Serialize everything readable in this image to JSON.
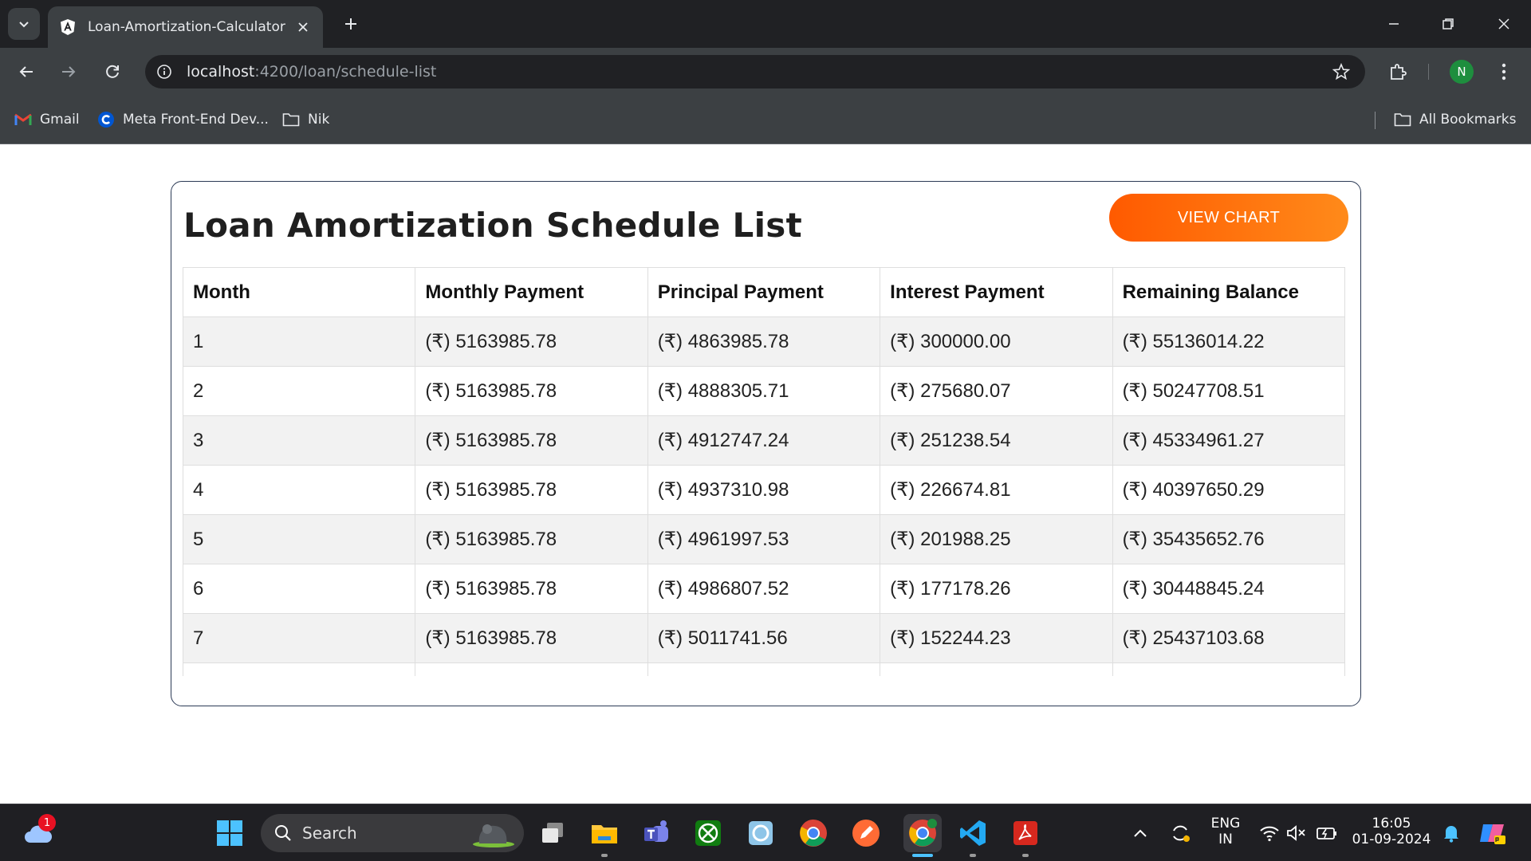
{
  "browser": {
    "tab_title": "Loan-Amortization-Calculator",
    "url_host": "localhost",
    "url_rest": ":4200/loan/schedule-list",
    "profile_initial": "N",
    "bookmarks": [
      {
        "label": "Gmail",
        "icon": "gmail-icon"
      },
      {
        "label": "Meta Front-End Dev...",
        "icon": "coursera-icon"
      },
      {
        "label": "Nik",
        "icon": "folder-icon"
      }
    ],
    "all_bookmarks_label": "All Bookmarks"
  },
  "page": {
    "title": "Loan Amortization Schedule List",
    "view_chart_label": "VIEW CHART",
    "accent_color": "#ff6a0d"
  },
  "table": {
    "headers": [
      "Month",
      "Monthly Payment",
      "Principal Payment",
      "Interest Payment",
      "Remaining Balance"
    ],
    "rows": [
      [
        "1",
        "(₹) 5163985.78",
        "(₹) 4863985.78",
        "(₹) 300000.00",
        "(₹) 55136014.22"
      ],
      [
        "2",
        "(₹) 5163985.78",
        "(₹) 4888305.71",
        "(₹) 275680.07",
        "(₹) 50247708.51"
      ],
      [
        "3",
        "(₹) 5163985.78",
        "(₹) 4912747.24",
        "(₹) 251238.54",
        "(₹) 45334961.27"
      ],
      [
        "4",
        "(₹) 5163985.78",
        "(₹) 4937310.98",
        "(₹) 226674.81",
        "(₹) 40397650.29"
      ],
      [
        "5",
        "(₹) 5163985.78",
        "(₹) 4961997.53",
        "(₹) 201988.25",
        "(₹) 35435652.76"
      ],
      [
        "6",
        "(₹) 5163985.78",
        "(₹) 4986807.52",
        "(₹) 177178.26",
        "(₹) 30448845.24"
      ],
      [
        "7",
        "(₹) 5163985.78",
        "(₹) 5011741.56",
        "(₹) 152244.23",
        "(₹) 25437103.68"
      ],
      [
        "",
        "",
        "",
        "",
        ""
      ]
    ]
  },
  "taskbar": {
    "search_label": "Search",
    "weather_badge": "1",
    "lang_line1": "ENG",
    "lang_line2": "IN",
    "time": "16:05",
    "date": "01-09-2024"
  }
}
